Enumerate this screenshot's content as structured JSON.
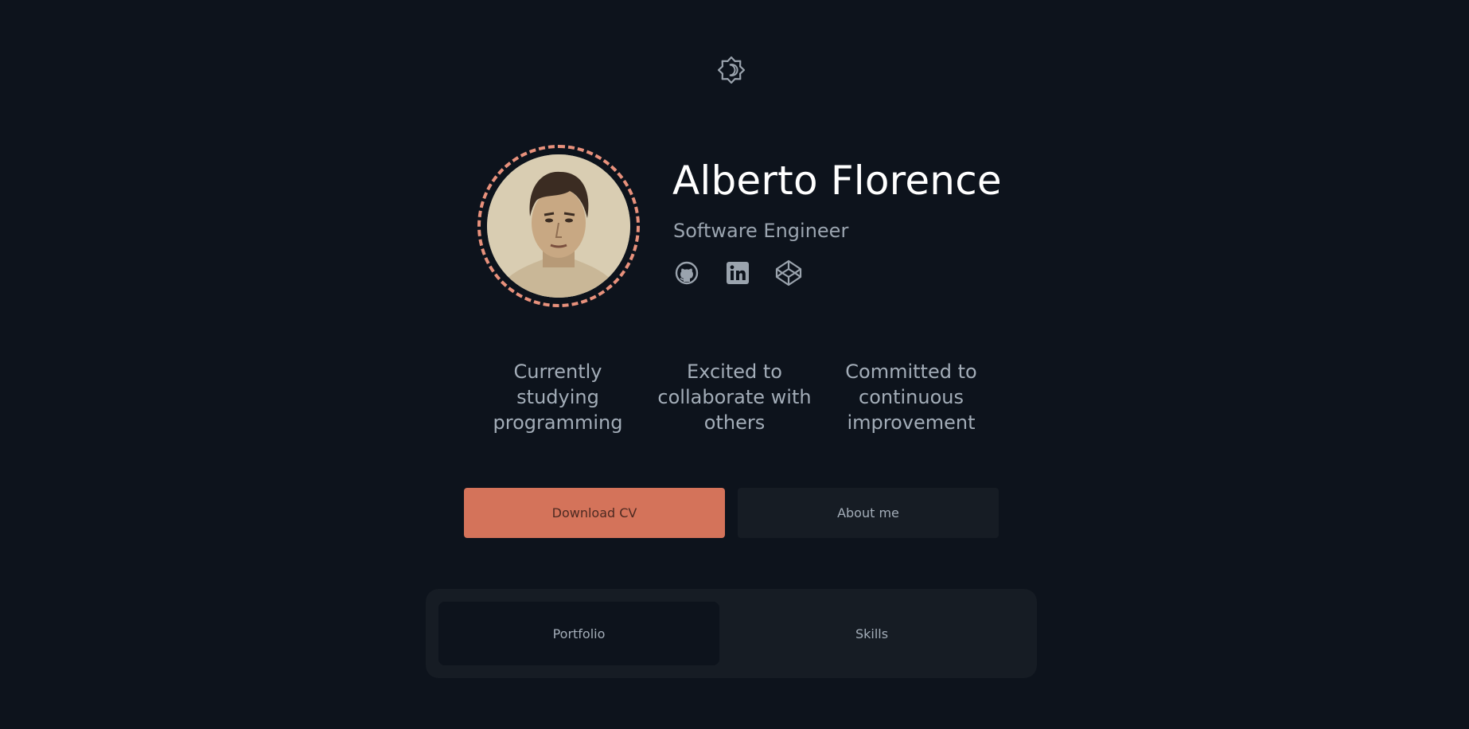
{
  "theme_toggle": {
    "icon": "moon-icon"
  },
  "profile": {
    "name": "Alberto Florence",
    "role": "Software Engineer",
    "avatar": "profile-photo"
  },
  "socials": [
    {
      "name": "GitHub",
      "icon": "github-icon"
    },
    {
      "name": "LinkedIn",
      "icon": "linkedin-icon"
    },
    {
      "name": "CodePen",
      "icon": "codepen-icon"
    }
  ],
  "traits": [
    {
      "lines": [
        "Currently",
        "studying",
        "programming"
      ]
    },
    {
      "lines": [
        "Excited to",
        "collaborate with",
        "others"
      ]
    },
    {
      "lines": [
        "Committed to",
        "continuous",
        "improvement"
      ]
    }
  ],
  "buttons": {
    "download_cv": "Download CV",
    "about_me": "About me"
  },
  "tabs": [
    {
      "label": "Portfolio",
      "active": true
    },
    {
      "label": "Skills",
      "active": false
    }
  ],
  "colors": {
    "background": "#0d131c",
    "accent": "#d4735a",
    "avatar_ring": "#e8917c",
    "surface": "#161c24"
  }
}
